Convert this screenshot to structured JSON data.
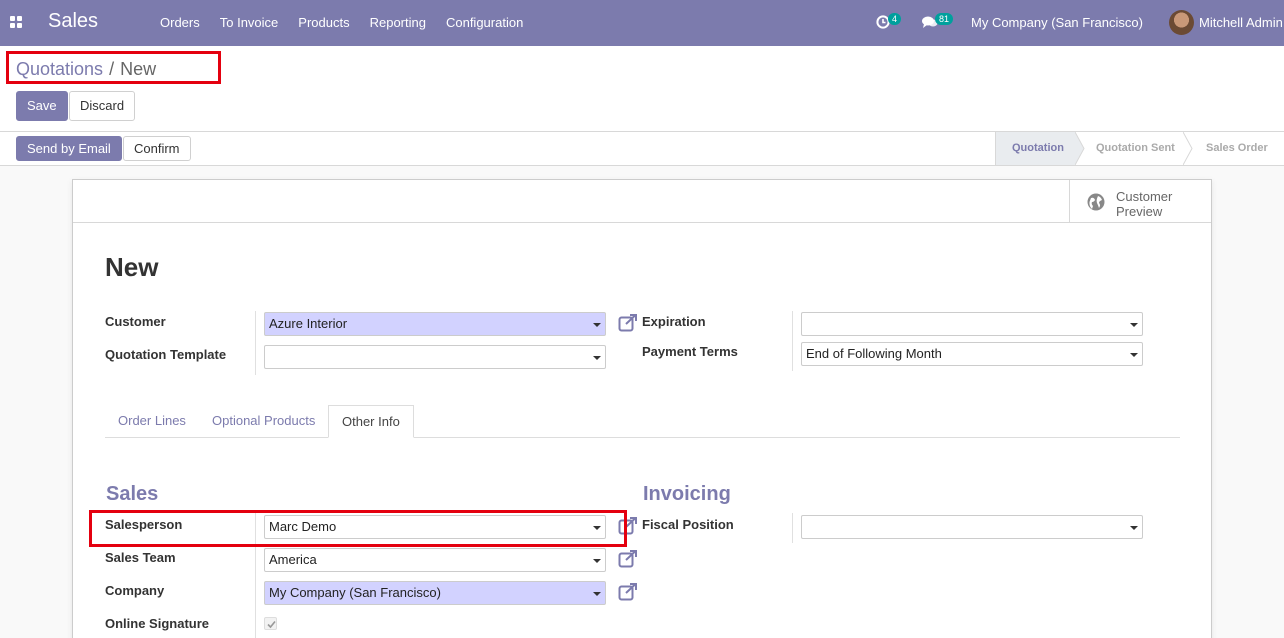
{
  "navbar": {
    "app_name": "Sales",
    "menu": [
      "Orders",
      "To Invoice",
      "Products",
      "Reporting",
      "Configuration"
    ],
    "activity_count": "4",
    "messages_count": "81",
    "company": "My Company (San Francisco)",
    "user": "Mitchell Admin",
    "bg_color": "#7c7bad"
  },
  "breadcrumb": {
    "parent": "Quotations",
    "separator": "/",
    "current": "New"
  },
  "buttons": {
    "save": "Save",
    "discard": "Discard",
    "send_by_email": "Send by Email",
    "confirm": "Confirm"
  },
  "statusbar": {
    "stages": [
      "Quotation",
      "Quotation Sent",
      "Sales Order"
    ],
    "active": "Quotation"
  },
  "sheet": {
    "button_box": {
      "customer_preview": "Customer Preview"
    },
    "title": "New",
    "customer_label": "Customer",
    "customer_value": "Azure Interior",
    "template_label": "Quotation Template",
    "template_value": "",
    "expiration_label": "Expiration",
    "expiration_value": "",
    "payment_terms_label": "Payment Terms",
    "payment_terms_value": "End of Following Month",
    "tabs": [
      "Order Lines",
      "Optional Products",
      "Other Info"
    ],
    "active_tab": "Other Info",
    "sales_section": "Sales",
    "invoicing_section": "Invoicing",
    "salesperson_label": "Salesperson",
    "salesperson_value": "Marc Demo",
    "sales_team_label": "Sales Team",
    "sales_team_value": "America",
    "company_label": "Company",
    "company_value": "My Company (San Francisco)",
    "online_signature_label": "Online Signature",
    "online_signature_checked": true,
    "fiscal_position_label": "Fiscal Position",
    "fiscal_position_value": ""
  },
  "colors": {
    "brand": "#7c7bad",
    "required_field": "#d2d2ff",
    "highlight_box": "#e4000f",
    "badge": "#00a09d"
  }
}
